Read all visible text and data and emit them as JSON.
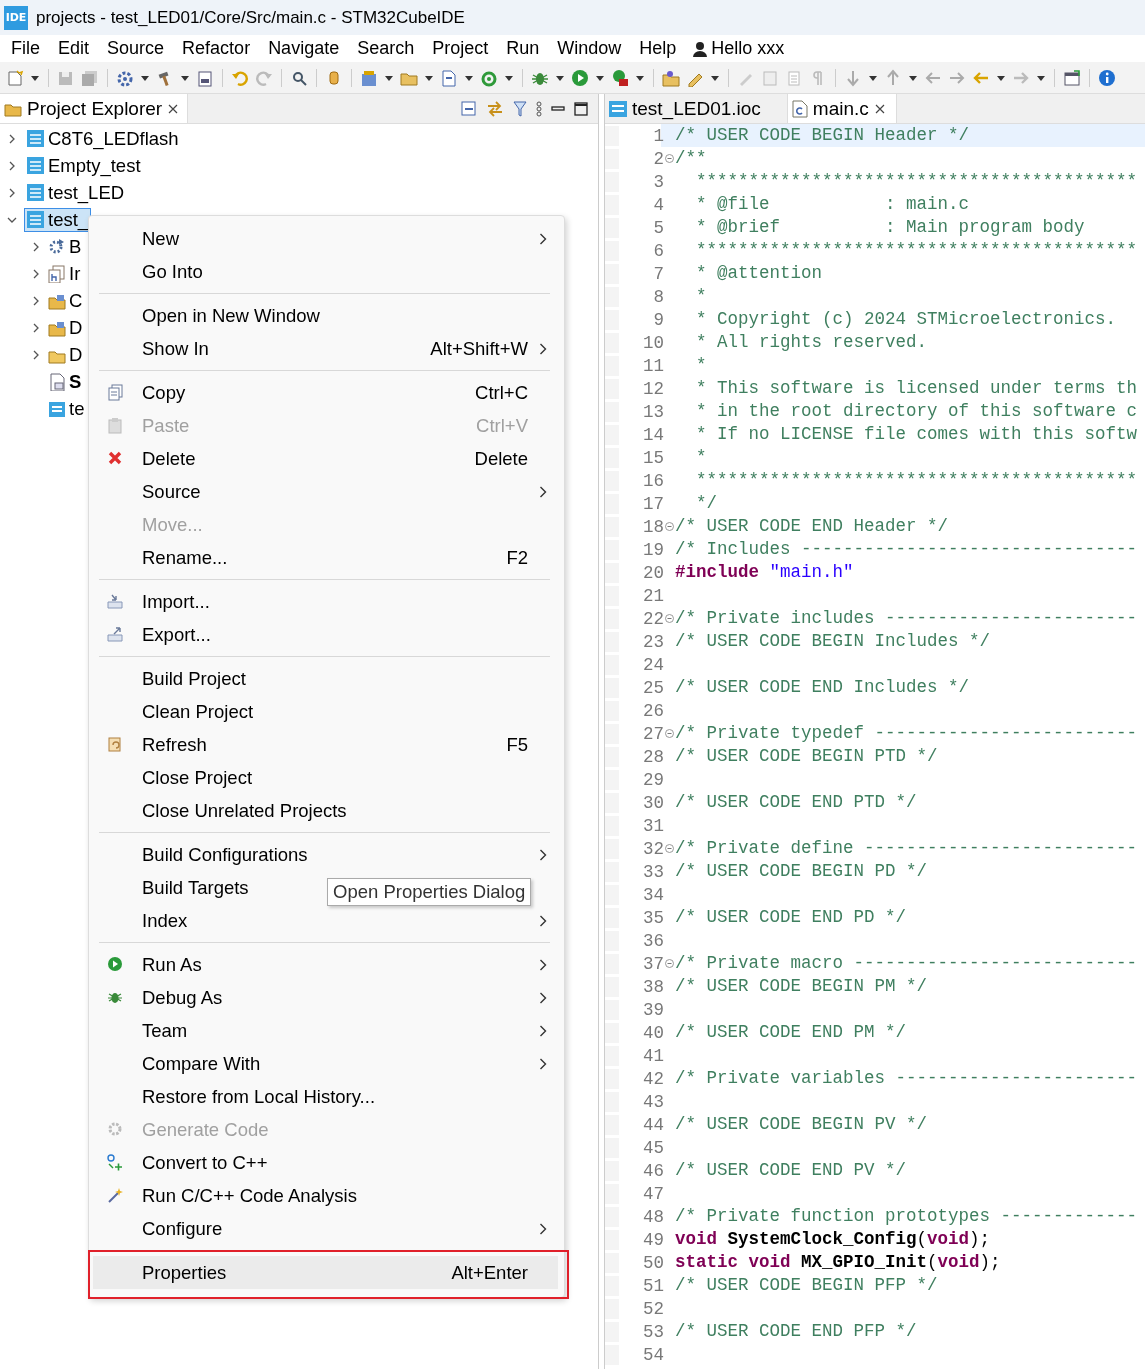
{
  "window": {
    "logo": "IDE",
    "title": "projects - test_LED01/Core/Src/main.c - STM32CubeIDE"
  },
  "menu": [
    "File",
    "Edit",
    "Source",
    "Refactor",
    "Navigate",
    "Search",
    "Project",
    "Run",
    "Window",
    "Help"
  ],
  "user": {
    "label": "Hello xxx"
  },
  "explorer": {
    "title": "Project Explorer",
    "tree": [
      {
        "label": "C8T6_LEDflash",
        "expanded": false,
        "selected": false
      },
      {
        "label": "Empty_test",
        "expanded": false,
        "selected": false
      },
      {
        "label": "test_LED",
        "expanded": false,
        "selected": false
      },
      {
        "label": "test_",
        "expanded": true,
        "selected": true,
        "children": [
          {
            "label": "B",
            "expandable": true,
            "bold": false
          },
          {
            "label": "Ir",
            "expandable": true,
            "bold": false
          },
          {
            "label": "C",
            "expandable": true,
            "bold": false
          },
          {
            "label": "D",
            "expandable": true,
            "bold": false
          },
          {
            "label": "D",
            "expandable": true,
            "bold": false
          },
          {
            "label": "S",
            "expandable": false,
            "bold": true
          },
          {
            "label": "te",
            "expandable": false,
            "bold": false
          }
        ]
      }
    ]
  },
  "editor": {
    "tabs": [
      {
        "label": "test_LED01.ioc",
        "selected": false,
        "closable": false
      },
      {
        "label": "main.c",
        "selected": true,
        "closable": true
      }
    ],
    "lines": [
      {
        "n": "1",
        "fold": false,
        "current": true,
        "segments": [
          {
            "kind": "comment",
            "text": "/* USER CODE BEGIN Header */"
          }
        ]
      },
      {
        "n": "2",
        "fold": true,
        "current": false,
        "segments": [
          {
            "kind": "comment",
            "text": "/**"
          }
        ]
      },
      {
        "n": "3",
        "fold": false,
        "current": false,
        "segments": [
          {
            "kind": "comment",
            "text": "  ******************************************"
          }
        ]
      },
      {
        "n": "4",
        "fold": false,
        "current": false,
        "segments": [
          {
            "kind": "comment",
            "text": "  * @file           : main.c"
          }
        ]
      },
      {
        "n": "5",
        "fold": false,
        "current": false,
        "segments": [
          {
            "kind": "comment",
            "text": "  * @brief          : Main program body"
          }
        ]
      },
      {
        "n": "6",
        "fold": false,
        "current": false,
        "segments": [
          {
            "kind": "comment",
            "text": "  ******************************************"
          }
        ]
      },
      {
        "n": "7",
        "fold": false,
        "current": false,
        "segments": [
          {
            "kind": "comment",
            "text": "  * @attention"
          }
        ]
      },
      {
        "n": "8",
        "fold": false,
        "current": false,
        "segments": [
          {
            "kind": "comment",
            "text": "  *"
          }
        ]
      },
      {
        "n": "9",
        "fold": false,
        "current": false,
        "segments": [
          {
            "kind": "comment",
            "text": "  * Copyright (c) 2024 STMicroelectronics."
          }
        ]
      },
      {
        "n": "10",
        "fold": false,
        "current": false,
        "segments": [
          {
            "kind": "comment",
            "text": "  * All rights reserved."
          }
        ]
      },
      {
        "n": "11",
        "fold": false,
        "current": false,
        "segments": [
          {
            "kind": "comment",
            "text": "  *"
          }
        ]
      },
      {
        "n": "12",
        "fold": false,
        "current": false,
        "segments": [
          {
            "kind": "comment",
            "text": "  * This software is licensed under terms th"
          }
        ]
      },
      {
        "n": "13",
        "fold": false,
        "current": false,
        "segments": [
          {
            "kind": "comment",
            "text": "  * in the root directory of this software c"
          }
        ]
      },
      {
        "n": "14",
        "fold": false,
        "current": false,
        "segments": [
          {
            "kind": "comment",
            "text": "  * If no LICENSE file comes with this softw"
          }
        ]
      },
      {
        "n": "15",
        "fold": false,
        "current": false,
        "segments": [
          {
            "kind": "comment",
            "text": "  *"
          }
        ]
      },
      {
        "n": "16",
        "fold": false,
        "current": false,
        "segments": [
          {
            "kind": "comment",
            "text": "  ******************************************"
          }
        ]
      },
      {
        "n": "17",
        "fold": false,
        "current": false,
        "segments": [
          {
            "kind": "comment",
            "text": "  */"
          }
        ]
      },
      {
        "n": "18",
        "fold": true,
        "current": false,
        "segments": [
          {
            "kind": "comment",
            "text": "/* USER CODE END Header */"
          }
        ]
      },
      {
        "n": "19",
        "fold": false,
        "current": false,
        "segments": [
          {
            "kind": "comment",
            "text": "/* Includes --------------------------------"
          }
        ]
      },
      {
        "n": "20",
        "fold": false,
        "current": false,
        "segments": [
          {
            "kind": "preproc",
            "text": "#include "
          },
          {
            "kind": "string",
            "text": "\"main.h\""
          }
        ]
      },
      {
        "n": "21",
        "fold": false,
        "current": false
      },
      {
        "n": "22",
        "fold": true,
        "current": false,
        "segments": [
          {
            "kind": "comment",
            "text": "/* Private includes ------------------------"
          }
        ]
      },
      {
        "n": "23",
        "fold": false,
        "current": false,
        "segments": [
          {
            "kind": "comment",
            "text": "/* USER CODE BEGIN Includes */"
          }
        ]
      },
      {
        "n": "24",
        "fold": false,
        "current": false
      },
      {
        "n": "25",
        "fold": false,
        "current": false,
        "segments": [
          {
            "kind": "comment",
            "text": "/* USER CODE END Includes */"
          }
        ]
      },
      {
        "n": "26",
        "fold": false,
        "current": false
      },
      {
        "n": "27",
        "fold": true,
        "current": false,
        "segments": [
          {
            "kind": "comment",
            "text": "/* Private typedef -------------------------"
          }
        ]
      },
      {
        "n": "28",
        "fold": false,
        "current": false,
        "segments": [
          {
            "kind": "comment",
            "text": "/* USER CODE BEGIN PTD */"
          }
        ]
      },
      {
        "n": "29",
        "fold": false,
        "current": false
      },
      {
        "n": "30",
        "fold": false,
        "current": false,
        "segments": [
          {
            "kind": "comment",
            "text": "/* USER CODE END PTD */"
          }
        ]
      },
      {
        "n": "31",
        "fold": false,
        "current": false
      },
      {
        "n": "32",
        "fold": true,
        "current": false,
        "segments": [
          {
            "kind": "comment",
            "text": "/* Private define --------------------------"
          }
        ]
      },
      {
        "n": "33",
        "fold": false,
        "current": false,
        "segments": [
          {
            "kind": "comment",
            "text": "/* USER CODE BEGIN PD */"
          }
        ]
      },
      {
        "n": "34",
        "fold": false,
        "current": false
      },
      {
        "n": "35",
        "fold": false,
        "current": false,
        "segments": [
          {
            "kind": "comment",
            "text": "/* USER CODE END PD */"
          }
        ]
      },
      {
        "n": "36",
        "fold": false,
        "current": false
      },
      {
        "n": "37",
        "fold": true,
        "current": false,
        "segments": [
          {
            "kind": "comment",
            "text": "/* Private macro ---------------------------"
          }
        ]
      },
      {
        "n": "38",
        "fold": false,
        "current": false,
        "segments": [
          {
            "kind": "comment",
            "text": "/* USER CODE BEGIN PM */"
          }
        ]
      },
      {
        "n": "39",
        "fold": false,
        "current": false
      },
      {
        "n": "40",
        "fold": false,
        "current": false,
        "segments": [
          {
            "kind": "comment",
            "text": "/* USER CODE END PM */"
          }
        ]
      },
      {
        "n": "41",
        "fold": false,
        "current": false
      },
      {
        "n": "42",
        "fold": false,
        "current": false,
        "segments": [
          {
            "kind": "comment",
            "text": "/* Private variables -----------------------"
          }
        ]
      },
      {
        "n": "43",
        "fold": false,
        "current": false
      },
      {
        "n": "44",
        "fold": false,
        "current": false,
        "segments": [
          {
            "kind": "comment",
            "text": "/* USER CODE BEGIN PV */"
          }
        ]
      },
      {
        "n": "45",
        "fold": false,
        "current": false
      },
      {
        "n": "46",
        "fold": false,
        "current": false,
        "segments": [
          {
            "kind": "comment",
            "text": "/* USER CODE END PV */"
          }
        ]
      },
      {
        "n": "47",
        "fold": false,
        "current": false
      },
      {
        "n": "48",
        "fold": false,
        "current": false,
        "segments": [
          {
            "kind": "comment",
            "text": "/* Private function prototypes -------------"
          }
        ]
      },
      {
        "n": "49",
        "fold": false,
        "current": false,
        "segments": [
          {
            "kind": "keyword",
            "text": "void "
          },
          {
            "kind": "function",
            "text": "SystemClock_Config"
          },
          {
            "kind": "plain",
            "text": "("
          },
          {
            "kind": "keyword",
            "text": "void"
          },
          {
            "kind": "plain",
            "text": ");"
          }
        ]
      },
      {
        "n": "50",
        "fold": false,
        "current": false,
        "segments": [
          {
            "kind": "keyword",
            "text": "static void "
          },
          {
            "kind": "function",
            "text": "MX_GPIO_Init"
          },
          {
            "kind": "plain",
            "text": "("
          },
          {
            "kind": "keyword",
            "text": "void"
          },
          {
            "kind": "plain",
            "text": ");"
          }
        ]
      },
      {
        "n": "51",
        "fold": false,
        "current": false,
        "segments": [
          {
            "kind": "comment",
            "text": "/* USER CODE BEGIN PFP */"
          }
        ]
      },
      {
        "n": "52",
        "fold": false,
        "current": false
      },
      {
        "n": "53",
        "fold": false,
        "current": false,
        "segments": [
          {
            "kind": "comment",
            "text": "/* USER CODE END PFP */"
          }
        ]
      },
      {
        "n": "54",
        "fold": false,
        "current": false
      }
    ]
  },
  "context_menu": {
    "items": [
      {
        "kind": "item",
        "label": "New",
        "submenu": true,
        "disabled": false,
        "marked": false
      },
      {
        "kind": "item",
        "label": "Go Into",
        "submenu": false,
        "disabled": false,
        "marked": false
      },
      {
        "kind": "separator"
      },
      {
        "kind": "item",
        "label": "Open in New Window",
        "submenu": false,
        "disabled": false,
        "marked": false
      },
      {
        "kind": "item",
        "label": "Show In",
        "shortcut": "Alt+Shift+W",
        "submenu": true,
        "disabled": false,
        "marked": false
      },
      {
        "kind": "separator"
      },
      {
        "kind": "item",
        "label": "Copy",
        "shortcut": "Ctrl+C",
        "submenu": false,
        "disabled": false,
        "marked": false
      },
      {
        "kind": "item",
        "label": "Paste",
        "shortcut": "Ctrl+V",
        "submenu": false,
        "disabled": true,
        "marked": false
      },
      {
        "kind": "item",
        "label": "Delete",
        "shortcut": "Delete",
        "submenu": false,
        "disabled": false,
        "marked": false
      },
      {
        "kind": "item",
        "label": "Source",
        "submenu": true,
        "disabled": false,
        "marked": false
      },
      {
        "kind": "item",
        "label": "Move...",
        "submenu": false,
        "disabled": true,
        "marked": false
      },
      {
        "kind": "item",
        "label": "Rename...",
        "shortcut": "F2",
        "submenu": false,
        "disabled": false,
        "marked": false
      },
      {
        "kind": "separator"
      },
      {
        "kind": "item",
        "label": "Import...",
        "submenu": false,
        "disabled": false,
        "marked": false
      },
      {
        "kind": "item",
        "label": "Export...",
        "submenu": false,
        "disabled": false,
        "marked": false
      },
      {
        "kind": "separator"
      },
      {
        "kind": "item",
        "label": "Build Project",
        "submenu": false,
        "disabled": false,
        "marked": false
      },
      {
        "kind": "item",
        "label": "Clean Project",
        "submenu": false,
        "disabled": false,
        "marked": false
      },
      {
        "kind": "item",
        "label": "Refresh",
        "shortcut": "F5",
        "submenu": false,
        "disabled": false,
        "marked": false
      },
      {
        "kind": "item",
        "label": "Close Project",
        "submenu": false,
        "disabled": false,
        "marked": false
      },
      {
        "kind": "item",
        "label": "Close Unrelated Projects",
        "submenu": false,
        "disabled": false,
        "marked": false
      },
      {
        "kind": "separator"
      },
      {
        "kind": "item",
        "label": "Build Configurations",
        "submenu": true,
        "disabled": false,
        "marked": false
      },
      {
        "kind": "item",
        "label": "Build Targets",
        "submenu": false,
        "disabled": false,
        "marked": false
      },
      {
        "kind": "item",
        "label": "Index",
        "submenu": true,
        "disabled": false,
        "marked": false
      },
      {
        "kind": "separator"
      },
      {
        "kind": "item",
        "label": "Run As",
        "submenu": true,
        "disabled": false,
        "marked": false
      },
      {
        "kind": "item",
        "label": "Debug As",
        "submenu": true,
        "disabled": false,
        "marked": false
      },
      {
        "kind": "item",
        "label": "Team",
        "submenu": true,
        "disabled": false,
        "marked": false
      },
      {
        "kind": "item",
        "label": "Compare With",
        "submenu": true,
        "disabled": false,
        "marked": false
      },
      {
        "kind": "item",
        "label": "Restore from Local History...",
        "submenu": false,
        "disabled": false,
        "marked": false
      },
      {
        "kind": "item",
        "label": "Generate Code",
        "submenu": false,
        "disabled": true,
        "marked": false
      },
      {
        "kind": "item",
        "label": "Convert to C++",
        "submenu": false,
        "disabled": false,
        "marked": false
      },
      {
        "kind": "item",
        "label": "Run C/C++ Code Analysis",
        "submenu": false,
        "disabled": false,
        "marked": false
      },
      {
        "kind": "item",
        "label": "Configure",
        "submenu": true,
        "disabled": false,
        "marked": false
      },
      {
        "kind": "separator"
      },
      {
        "kind": "item",
        "label": "Properties",
        "shortcut": "Alt+Enter",
        "submenu": false,
        "disabled": false,
        "marked": true
      }
    ]
  },
  "tooltip": {
    "text": "Open Properties Dialog"
  }
}
